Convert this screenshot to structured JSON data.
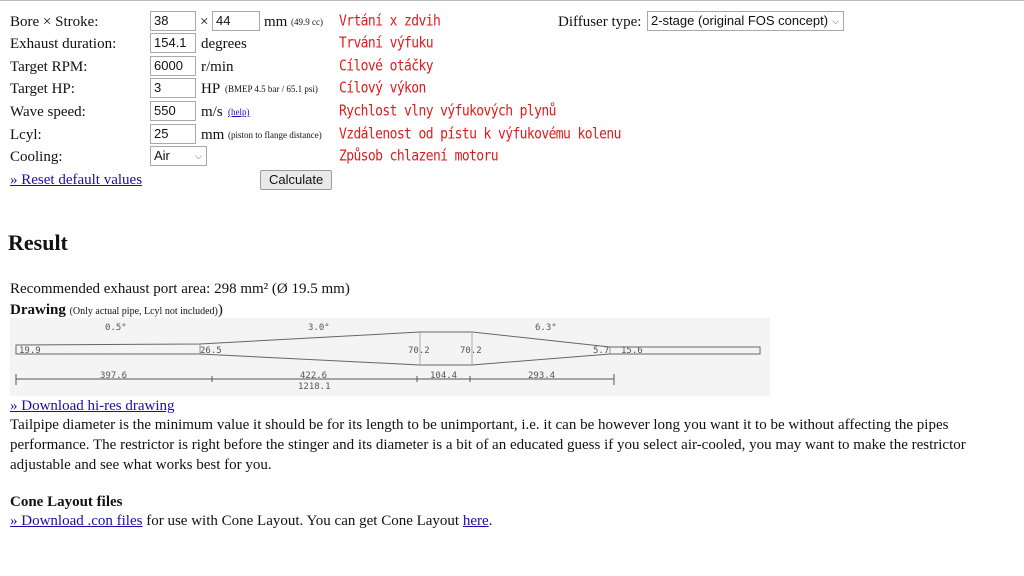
{
  "form": {
    "bore_stroke": {
      "label": "Bore × Stroke:",
      "bore": "38",
      "times": "×",
      "stroke": "44",
      "unit": "mm",
      "volume": "(49.9 cc)",
      "note": "Vrtání x zdvih"
    },
    "exhaust_duration": {
      "label": "Exhaust duration:",
      "value": "154.1",
      "unit": "degrees",
      "note": "Trvání výfuku"
    },
    "target_rpm": {
      "label": "Target RPM:",
      "value": "6000",
      "unit": "r/min",
      "note": "Cílové otáčky"
    },
    "target_hp": {
      "label": "Target HP:",
      "value": "3",
      "unit": "HP",
      "extra": "(BMEP 4.5 bar / 65.1 psi)",
      "note": "Cílový výkon"
    },
    "wave_speed": {
      "label": "Wave speed:",
      "value": "550",
      "unit": "m/s",
      "help": "(help)",
      "note": "Rychlost vlny výfukových plynů"
    },
    "lcyl": {
      "label": "Lcyl:",
      "value": "25",
      "unit": "mm",
      "extra": "(piston to flange distance)",
      "note": "Vzdálenost od pístu k výfukovému kolenu"
    },
    "cooling": {
      "label": "Cooling:",
      "value": "Air",
      "note": "Způsob chlazení motoru"
    },
    "diffuser": {
      "label": "Diffuser type:",
      "value": "2-stage (original FOS concept)"
    },
    "reset_link": "» Reset default values",
    "calculate_label": "Calculate"
  },
  "result": {
    "heading": "Result",
    "port_area": "Recommended exhaust port area: 298 mm² (Ø 19.5 mm)",
    "drawing_title": "Drawing",
    "drawing_note": "(Only actual pipe, Lcyl not included)",
    "drawing_close_paren": ")",
    "download_drawing": "» Download hi-res drawing",
    "description": "Tailpipe diameter is the minimum value it should be for its length to be unimportant, i.e. it can be however long you want it to be without affecting the pipes performance. The restrictor is right before the stinger and its diameter is a bit of an educated guess if you select air-cooled, you may want to make the restrictor adjustable and see what works best for you."
  },
  "drawing": {
    "angles": [
      "0.5°",
      "3.0°",
      "6.3°"
    ],
    "diameters": [
      "19.9",
      "26.5",
      "70.2",
      "70.2",
      "5.7",
      "15.6"
    ],
    "lengths": [
      "397.6",
      "422.6",
      "104.4",
      "293.4"
    ],
    "total": "1218.1"
  },
  "cone": {
    "heading": "Cone Layout files",
    "download_link": "» Download .con files",
    "text_after": " for use with Cone Layout. You can get Cone Layout ",
    "here_link": "here",
    "period": "."
  }
}
